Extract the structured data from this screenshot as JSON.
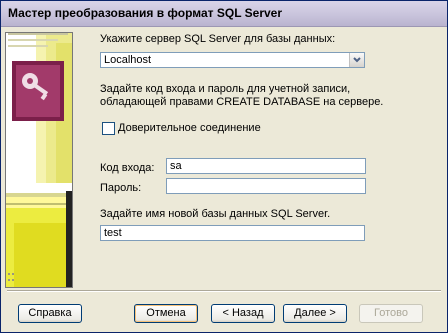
{
  "window": {
    "title": "Мастер преобразования в формат SQL Server"
  },
  "server": {
    "prompt": "Укажите сервер SQL Server для базы данных:",
    "value": "Localhost"
  },
  "login_hint": {
    "line1": "Задайте код входа и пароль для учетной записи,",
    "line2": "обладающей правами CREATE DATABASE на сервере."
  },
  "trusted": {
    "label": "Доверительное соединение",
    "checked": false
  },
  "login": {
    "label": "Код входа:",
    "value": "sa"
  },
  "password": {
    "label": "Пароль:",
    "value": ""
  },
  "database": {
    "prompt": "Задайте имя новой базы данных SQL Server.",
    "value": "test"
  },
  "buttons": {
    "help": "Справка",
    "cancel": "Отмена",
    "back": "< Назад",
    "next": "Далее >",
    "finish": "Готово"
  },
  "icons": [
    "key-icon",
    "dropdown-arrow-icon"
  ]
}
